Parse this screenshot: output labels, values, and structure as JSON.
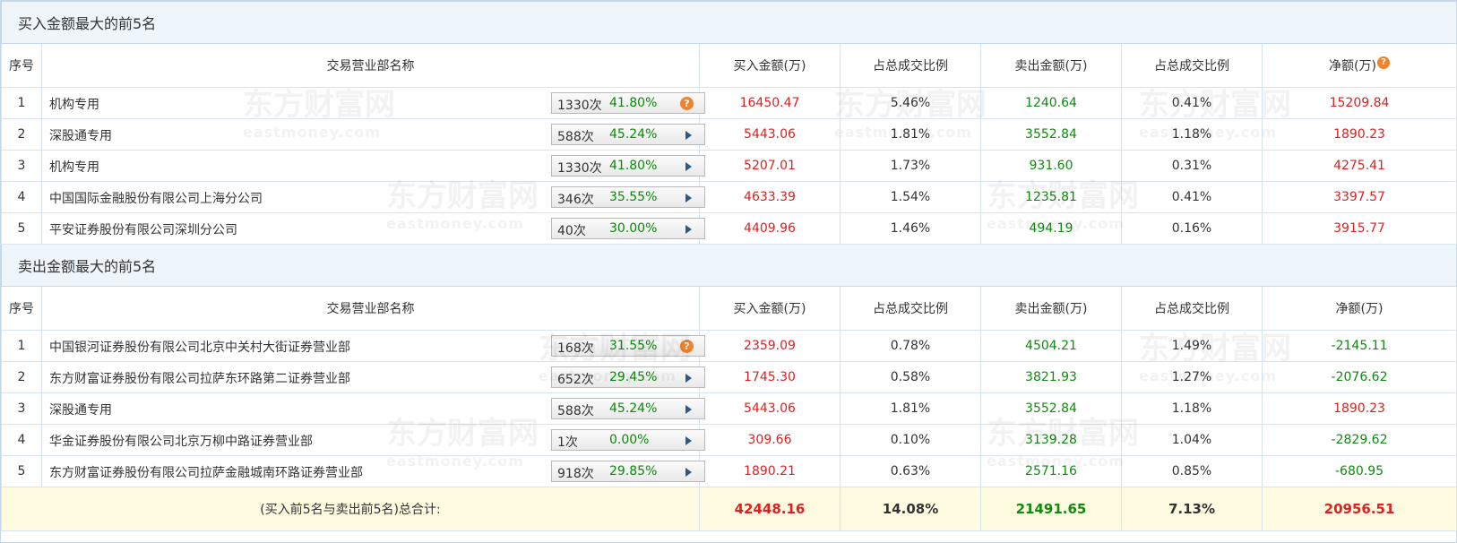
{
  "buy_section": {
    "title": "买入金额最大的前5名",
    "headers": [
      "序号",
      "交易营业部名称",
      "买入金额(万)",
      "占总成交比例",
      "卖出金额(万)",
      "占总成交比例",
      "净额(万)"
    ],
    "rows": [
      {
        "no": "1",
        "name": "机构专用",
        "count": "1330次",
        "pct": "41.80%",
        "icon": "question-icon",
        "buy": "16450.47",
        "buy_ratio": "5.46%",
        "sell": "1240.64",
        "sell_ratio": "0.41%",
        "net": "15209.84"
      },
      {
        "no": "2",
        "name": "深股通专用",
        "count": "588次",
        "pct": "45.24%",
        "icon": "arrow-right-icon",
        "buy": "5443.06",
        "buy_ratio": "1.81%",
        "sell": "3552.84",
        "sell_ratio": "1.18%",
        "net": "1890.23"
      },
      {
        "no": "3",
        "name": "机构专用",
        "count": "1330次",
        "pct": "41.80%",
        "icon": "arrow-right-icon",
        "buy": "5207.01",
        "buy_ratio": "1.73%",
        "sell": "931.60",
        "sell_ratio": "0.31%",
        "net": "4275.41"
      },
      {
        "no": "4",
        "name": "中国国际金融股份有限公司上海分公司",
        "count": "346次",
        "pct": "35.55%",
        "icon": "arrow-right-icon",
        "buy": "4633.39",
        "buy_ratio": "1.54%",
        "sell": "1235.81",
        "sell_ratio": "0.41%",
        "net": "3397.57"
      },
      {
        "no": "5",
        "name": "平安证券股份有限公司深圳分公司",
        "count": "40次",
        "pct": "30.00%",
        "icon": "arrow-right-icon",
        "buy": "4409.96",
        "buy_ratio": "1.46%",
        "sell": "494.19",
        "sell_ratio": "0.16%",
        "net": "3915.77"
      }
    ]
  },
  "sell_section": {
    "title": "卖出金额最大的前5名",
    "headers": [
      "序号",
      "交易营业部名称",
      "买入金额(万)",
      "占总成交比例",
      "卖出金额(万)",
      "占总成交比例",
      "净额(万)"
    ],
    "rows": [
      {
        "no": "1",
        "name": "中国银河证券股份有限公司北京中关村大街证券营业部",
        "count": "168次",
        "pct": "31.55%",
        "icon": "question-icon",
        "buy": "2359.09",
        "buy_ratio": "0.78%",
        "sell": "4504.21",
        "sell_ratio": "1.49%",
        "net": "-2145.11"
      },
      {
        "no": "2",
        "name": "东方财富证券股份有限公司拉萨东环路第二证券营业部",
        "count": "652次",
        "pct": "29.45%",
        "icon": "arrow-right-icon",
        "buy": "1745.30",
        "buy_ratio": "0.58%",
        "sell": "3821.93",
        "sell_ratio": "1.27%",
        "net": "-2076.62"
      },
      {
        "no": "3",
        "name": "深股通专用",
        "count": "588次",
        "pct": "45.24%",
        "icon": "arrow-right-icon",
        "buy": "5443.06",
        "buy_ratio": "1.81%",
        "sell": "3552.84",
        "sell_ratio": "1.18%",
        "net": "1890.23"
      },
      {
        "no": "4",
        "name": "华金证券股份有限公司北京万柳中路证券营业部",
        "count": "1次",
        "pct": "0.00%",
        "icon": "arrow-right-icon",
        "buy": "309.66",
        "buy_ratio": "0.10%",
        "sell": "3139.28",
        "sell_ratio": "1.04%",
        "net": "-2829.62"
      },
      {
        "no": "5",
        "name": "东方财富证券股份有限公司拉萨金融城南环路证券营业部",
        "count": "918次",
        "pct": "29.85%",
        "icon": "arrow-right-icon",
        "buy": "1890.21",
        "buy_ratio": "0.63%",
        "sell": "2571.16",
        "sell_ratio": "0.85%",
        "net": "-680.95"
      }
    ]
  },
  "total": {
    "label": "(买入前5名与卖出前5名)总合计:",
    "buy": "42448.16",
    "buy_ratio": "14.08%",
    "sell": "21491.65",
    "sell_ratio": "7.13%",
    "net": "20956.51"
  },
  "watermark": {
    "cn": "东方财富网",
    "en": "eastmoney.com"
  },
  "colors": {
    "positive": "#e02020",
    "negative": "#108a10",
    "section_bg": "#eef5fb",
    "total_bg": "#fffbe0",
    "help_icon": "#f0832b"
  }
}
